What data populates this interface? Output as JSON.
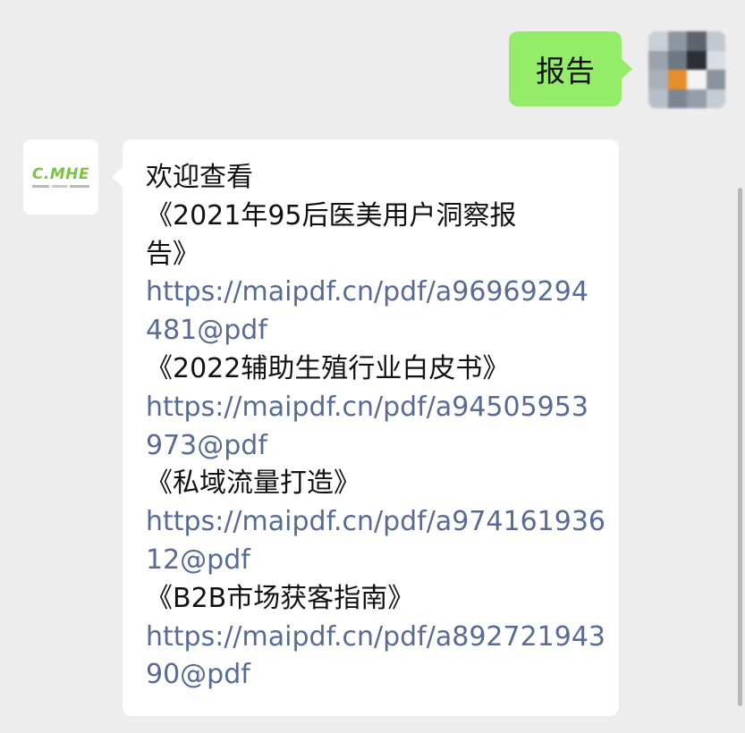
{
  "chat": {
    "outgoing": {
      "text": "报告"
    },
    "incoming": {
      "sender_logo_text": "C.MHE",
      "lines": [
        {
          "text": "欢迎查看",
          "type": "text"
        },
        {
          "text": "《2021年95后医美用户洞察报",
          "type": "text"
        },
        {
          "text": "告》",
          "type": "text"
        },
        {
          "text": "https://maipdf.cn/pdf/a96969294",
          "type": "link"
        },
        {
          "text": "481@pdf",
          "type": "link"
        },
        {
          "text": "《2022辅助生殖行业白皮书》",
          "type": "text"
        },
        {
          "text": "https://maipdf.cn/pdf/a94505953",
          "type": "link"
        },
        {
          "text": "973@pdf",
          "type": "link"
        },
        {
          "text": "《私域流量打造》",
          "type": "text"
        },
        {
          "text": "https://maipdf.cn/pdf/a974161936",
          "type": "link"
        },
        {
          "text": "12@pdf",
          "type": "link"
        },
        {
          "text": "《B2B市场获客指南》",
          "type": "text"
        },
        {
          "text": "https://maipdf.cn/pdf/a892721943",
          "type": "link"
        },
        {
          "text": "90@pdf",
          "type": "link"
        }
      ]
    }
  },
  "colors": {
    "background": "#ededed",
    "outgoing_bubble": "#95ec69",
    "incoming_bubble": "#ffffff",
    "link": "#576b95",
    "logo_green": "#7cc243"
  }
}
